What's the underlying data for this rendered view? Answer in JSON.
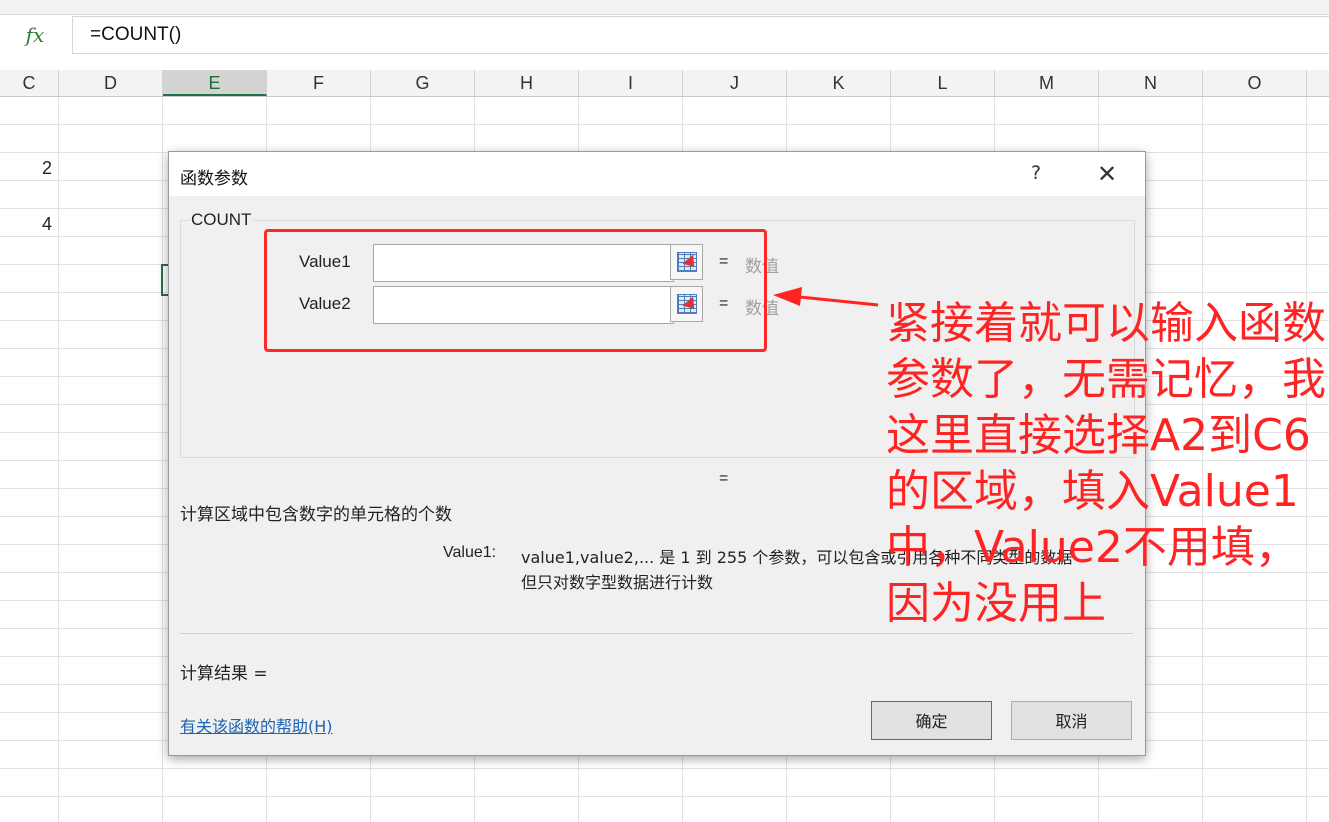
{
  "formula_bar": {
    "fx_icon": "fx",
    "formula": "=COUNT()"
  },
  "columns": [
    "C",
    "D",
    "E",
    "F",
    "G",
    "H",
    "I",
    "J",
    "K",
    "L",
    "M",
    "N",
    "O"
  ],
  "selected_column": "E",
  "cells": [
    {
      "value": "2"
    },
    {
      "value": "4"
    }
  ],
  "dialog": {
    "title": "函数参数",
    "help_glyph": "?",
    "close_glyph": "✕",
    "function_name": "COUNT",
    "args": [
      {
        "label": "Value1",
        "value": "",
        "eq": "=",
        "hint": "数值"
      },
      {
        "label": "Value2",
        "value": "",
        "eq": "=",
        "hint": "数值"
      }
    ],
    "result_eq": "=",
    "description": "计算区域中包含数字的单元格的个数",
    "arg_help_name": "Value1:",
    "arg_help_line1": "value1,value2,... 是 1 到 255 个参数，可以包含或引用各种不同类型的数据",
    "arg_help_line2": "但只对数字型数据进行计数",
    "result_label": "计算结果 =",
    "help_link": "有关该函数的帮助(H)",
    "ok_label": "确定",
    "cancel_label": "取消"
  },
  "annotation": {
    "text": "紧接着就可以输入函数参数了，无需记忆，我这里直接选择A2到C6的区域，填入Value1 中，Value2不用填，因为没用上",
    "color": "#ff2424"
  }
}
